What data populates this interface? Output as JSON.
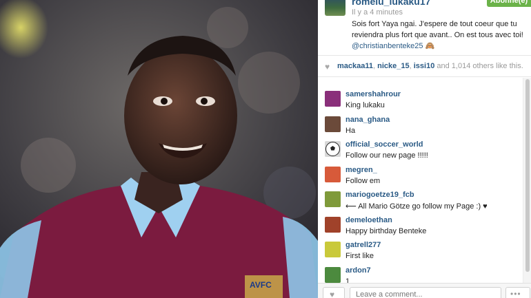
{
  "post": {
    "username": "romelu_lukaku17",
    "follow_label": "Abonné(e)",
    "time": "Il y a 4 minutes",
    "caption": "Sois fort Yaya ngai. J'espere de tout coeur que tu reviendra plus fort que avant.. On est tous avec toi!",
    "mention": "@christianbenteke25",
    "emoji": "🙈"
  },
  "likes": {
    "users": [
      "mackaa11",
      "nicke_15",
      "issi10"
    ],
    "sep1": ", ",
    "sep2": ", ",
    "and_label": " and ",
    "count": "1,014",
    "suffix": " others like this."
  },
  "comments": [
    {
      "user": "samershahrour",
      "text": "King lukaku",
      "avatar_color": "#8a2f7a"
    },
    {
      "user": "nana_ghana",
      "text": "Ha",
      "avatar_color": "#6b4a3a"
    },
    {
      "user": "official_soccer_world",
      "text": "Follow our new page !!!!!",
      "avatar_color": "#d8d8d8"
    },
    {
      "user": "megren_",
      "text": "Follow em",
      "avatar_color": "#d75a3a"
    },
    {
      "user": "mariogoetze19_fcb",
      "text": "⟵ All Mario Götze go follow my Page :) ♥",
      "avatar_color": "#7f9a3a"
    },
    {
      "user": "demeloethan",
      "text": "Happy birthday Benteke",
      "avatar_color": "#a0422a"
    },
    {
      "user": "gatrell277",
      "text": "First like",
      "avatar_color": "#c9c93a"
    },
    {
      "user": "ardon7",
      "text": "1",
      "avatar_color": "#4c8a3e"
    }
  ],
  "bottom": {
    "comment_placeholder": "Leave a comment..."
  },
  "photo": {
    "badge_text": "AVFC",
    "shirt_color": "#7b1b3f",
    "sleeve_color": "#9fd0f0"
  }
}
